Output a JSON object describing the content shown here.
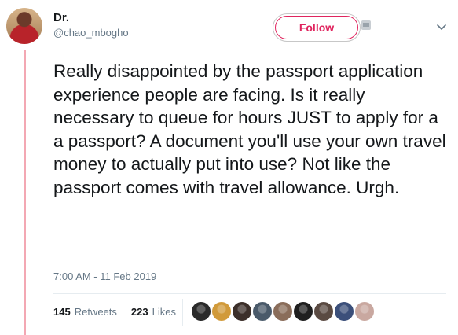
{
  "tweet": {
    "author_name": "Dr.",
    "author_handle": "@chao_mbogho",
    "follow_label": "Follow",
    "text": "Really disappointed by the passport application experience people are facing. Is it really necessary to queue for hours JUST to apply for a a passport? A document you'll use your own travel money to actually put into use? Not like the passport comes with travel allowance. Urgh.",
    "timestamp": "7:00 AM - 11 Feb 2019",
    "retweets_count": "145",
    "retweets_label": "Retweets",
    "likes_count": "223",
    "likes_label": "Likes"
  },
  "likers": [
    {
      "color": "#2b2b2b"
    },
    {
      "color": "#d19a3a"
    },
    {
      "color": "#3c2f2a"
    },
    {
      "color": "#4a5a6a"
    },
    {
      "color": "#8a6d5a"
    },
    {
      "color": "#1f1f1f"
    },
    {
      "color": "#5a4a42"
    },
    {
      "color": "#3b4f7a"
    },
    {
      "color": "#c9a8a0"
    }
  ],
  "colors": {
    "accent": "#e0245e",
    "thread_line": "#f3a8b3",
    "secondary_text": "#657786"
  },
  "icons": {
    "chevron": "chevron-down-icon",
    "small_icon": "image-icon"
  }
}
